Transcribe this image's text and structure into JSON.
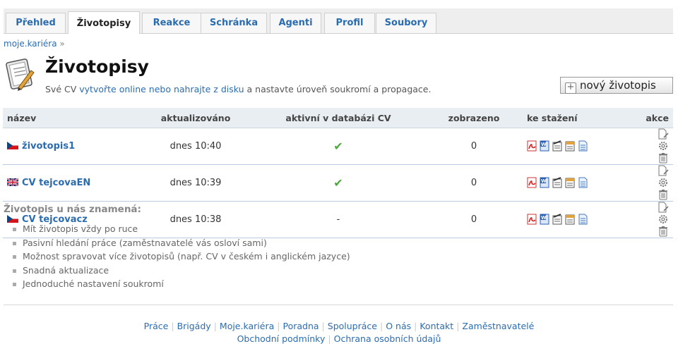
{
  "tabs": [
    {
      "label": "Přehled"
    },
    {
      "label": "Životopisy"
    },
    {
      "label": "Reakce"
    },
    {
      "label": "Schránka"
    },
    {
      "label": "Agenti"
    },
    {
      "label": "Profil"
    },
    {
      "label": "Soubory"
    }
  ],
  "breadcrumb": {
    "link": "moje.kariéra",
    "sep": "»"
  },
  "header": {
    "title": "Životopisy",
    "desc_before": "Své CV ",
    "desc_link": "vytvořte online nebo nahrajte z disku",
    "desc_after": " a nastavte úroveň soukromí a propagace.",
    "new_button": "nový životopis"
  },
  "table": {
    "columns": {
      "name": "název",
      "updated": "aktualizováno",
      "active": "aktivní v databázi CV",
      "views": "zobrazeno",
      "download": "ke stažení",
      "actions": "akce"
    },
    "rows": [
      {
        "flag": "cz",
        "name": "životopis1",
        "updated": "dnes 10:40",
        "active": "✔",
        "views": "0"
      },
      {
        "flag": "gb",
        "name": "CV tejcovaEN",
        "updated": "dnes 10:39",
        "active": "✔",
        "views": "0"
      },
      {
        "flag": "cz",
        "name": "CV tejcovacz",
        "updated": "dnes 10:38",
        "active": "-",
        "views": "0"
      }
    ]
  },
  "info": {
    "title": "Životopis u nás znamená:",
    "items": [
      "Mít životopis vždy po ruce",
      "Pasivní hledání práce (zaměstnavatelé vás osloví sami)",
      "Možnost spravovat více životopisů (např. CV v českém i anglickém jazyce)",
      "Snadná aktualizace",
      "Jednoduché nastavení soukromí"
    ]
  },
  "footer": {
    "links": [
      "Práce",
      "Brigády",
      "Moje.kariéra",
      "Poradna",
      "Spolupráce",
      "O nás",
      "Kontakt",
      "Zaměstnavatelé"
    ],
    "links2": [
      "Obchodní podmínky",
      "Ochrana osobních údajů"
    ]
  },
  "colors": {
    "link": "#2b6cb0",
    "check": "#4ca93a",
    "header_bg": "#e9eef3"
  }
}
